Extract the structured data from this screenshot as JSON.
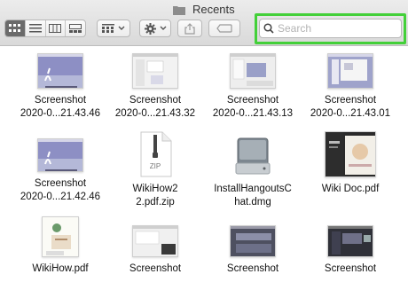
{
  "window": {
    "title": "Recents"
  },
  "toolbar": {
    "view_icons": [
      "icon-view-icon",
      "list-view-icon",
      "column-view-icon",
      "gallery-view-icon"
    ],
    "search": {
      "placeholder": "Search",
      "value": ""
    }
  },
  "files": [
    {
      "line1": "Screenshot",
      "line2": "2020-0...21.43.46"
    },
    {
      "line1": "Screenshot",
      "line2": "2020-0...21.43.32"
    },
    {
      "line1": "Screenshot",
      "line2": "2020-0...21.43.13"
    },
    {
      "line1": "Screenshot",
      "line2": "2020-0...21.43.01"
    },
    {
      "line1": "Screenshot",
      "line2": "2020-0...21.42.46"
    },
    {
      "line1": "WikiHow2",
      "line2": "2.pdf.zip"
    },
    {
      "line1": "InstallHangoutsC",
      "line2": "hat.dmg"
    },
    {
      "line1": "Wiki Doc.pdf",
      "line2": ""
    },
    {
      "line1": "WikiHow.pdf",
      "line2": ""
    },
    {
      "line1": "Screenshot",
      "line2": ""
    },
    {
      "line1": "Screenshot",
      "line2": ""
    },
    {
      "line1": "Screenshot",
      "line2": ""
    }
  ],
  "zip_badge": "ZIP",
  "colors": {
    "highlight": "#43d039",
    "active_segment": "#6b6b6b"
  }
}
